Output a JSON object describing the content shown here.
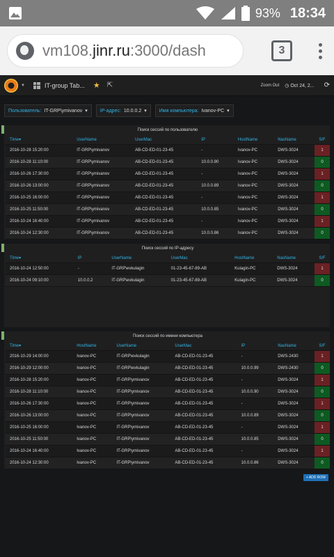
{
  "statusbar": {
    "battery": "93%",
    "time": "18:34"
  },
  "browser": {
    "url_prefix": "vm108.",
    "url_domain": "jinr.ru",
    "url_suffix": ":3000/dash",
    "tab_count": "3"
  },
  "grafana": {
    "dashboard_title": "IT-group Tab...",
    "zoom_out": "Zoom Out",
    "time_range": "Oct 24, 2..."
  },
  "variables": [
    {
      "label": "Пользователь:",
      "value": "IT-GRP\\ymivanov"
    },
    {
      "label": "IP-адрес:",
      "value": "10.0.0.2"
    },
    {
      "label": "Имя компьютера:",
      "value": "Ivanov-PC"
    }
  ],
  "panel1": {
    "title": "Поиск сессий по пользователю",
    "columns": [
      "Time",
      "UserName",
      "UserMac",
      "IP",
      "HostName",
      "NasName",
      "S/F"
    ],
    "rows": [
      [
        "2016-10-28 15:20:00",
        "IT-GRP\\ymivanov",
        "AB-CD-ED-01-23-45",
        "-",
        "Ivanov-PC",
        "DWS-3024",
        "1"
      ],
      [
        "2016-10-28 11:10:00",
        "IT-GRP\\ymivanov",
        "AB-CD-ED-01-23-45",
        "10.0.0.90",
        "Ivanov-PC",
        "DWS-3024",
        "0"
      ],
      [
        "2016-10-26 17:30:00",
        "IT-GRP\\ymivanov",
        "AB-CD-ED-01-23-45",
        "-",
        "Ivanov-PC",
        "DWS-3024",
        "1"
      ],
      [
        "2016-10-26 13:00:00",
        "IT-GRP\\ymivanov",
        "AB-CD-ED-01-23-45",
        "10.0.0.89",
        "Ivanov-PC",
        "DWS-3024",
        "0"
      ],
      [
        "2016-10-25 16:00:00",
        "IT-GRP\\ymivanov",
        "AB-CD-ED-01-23-45",
        "-",
        "Ivanov-PC",
        "DWS-3024",
        "1"
      ],
      [
        "2016-10-25 11:50:00",
        "IT-GRP\\ymivanov",
        "AB-CD-ED-01-23-45",
        "10.0.0.85",
        "Ivanov-PC",
        "DWS-3024",
        "0"
      ],
      [
        "2016-10-24 16:40:00",
        "IT-GRP\\ymivanov",
        "AB-CD-ED-01-23-45",
        "-",
        "Ivanov-PC",
        "DWS-3024",
        "1"
      ],
      [
        "2016-10-24 12:30:00",
        "IT-GRP\\ymivanov",
        "AB-CD-ED-01-23-45",
        "10.0.0.86",
        "Ivanov-PC",
        "DWS-3024",
        "0"
      ]
    ]
  },
  "panel2": {
    "title": "Поиск сессий по IP-адресу",
    "columns": [
      "Time",
      "IP",
      "UserName",
      "UserMac",
      "HostName",
      "NasName",
      "S/F"
    ],
    "rows": [
      [
        "2016-10-24 12:50:00",
        "-",
        "IT-GRP\\evkulagin",
        "01-23-45-67-89-AB",
        "Kulagin-PC",
        "DWS-3024",
        "1"
      ],
      [
        "2016-10-24 09:10:00",
        "10.0.0.2",
        "IT-GRP\\evkulagin",
        "01-23-45-67-89-AB",
        "Kulagin-PC",
        "DWS-3024",
        "0"
      ]
    ]
  },
  "panel3": {
    "title": "Поиск сессий по имени компьютера",
    "columns": [
      "Time",
      "HostName",
      "UserName",
      "UserMac",
      "IP",
      "NasName",
      "S/F"
    ],
    "rows": [
      [
        "2016-10-29 14:00:00",
        "Ivanov-PC",
        "IT-GRP\\evkulagin",
        "AB-CD-ED-01-23-45",
        "-",
        "DWS-2430",
        "1"
      ],
      [
        "2016-10-29 12:00:00",
        "Ivanov-PC",
        "IT-GRP\\evkulagin",
        "AB-CD-ED-01-23-45",
        "10.0.0.99",
        "DWS-2430",
        "0"
      ],
      [
        "2016-10-28 15:20:00",
        "Ivanov-PC",
        "IT-GRP\\ymivanov",
        "AB-CD-ED-01-23-45",
        "-",
        "DWS-3024",
        "1"
      ],
      [
        "2016-10-28 11:10:00",
        "Ivanov-PC",
        "IT-GRP\\ymivanov",
        "AB-CD-ED-01-23-45",
        "10.0.0.90",
        "DWS-3024",
        "0"
      ],
      [
        "2016-10-26 17:30:00",
        "Ivanov-PC",
        "IT-GRP\\ymivanov",
        "AB-CD-ED-01-23-45",
        "-",
        "DWS-3024",
        "1"
      ],
      [
        "2016-10-26 13:00:00",
        "Ivanov-PC",
        "IT-GRP\\ymivanov",
        "AB-CD-ED-01-23-45",
        "10.0.0.89",
        "DWS-3024",
        "0"
      ],
      [
        "2016-10-25 16:00:00",
        "Ivanov-PC",
        "IT-GRP\\ymivanov",
        "AB-CD-ED-01-23-45",
        "-",
        "DWS-3024",
        "1"
      ],
      [
        "2016-10-25 11:50:00",
        "Ivanov-PC",
        "IT-GRP\\ymivanov",
        "AB-CD-ED-01-23-45",
        "10.0.0.85",
        "DWS-3024",
        "0"
      ],
      [
        "2016-10-24 16:40:00",
        "Ivanov-PC",
        "IT-GRP\\ymivanov",
        "AB-CD-ED-01-23-45",
        "-",
        "DWS-3024",
        "1"
      ],
      [
        "2016-10-24 12:30:00",
        "Ivanov-PC",
        "IT-GRP\\ymivanov",
        "AB-CD-ED-01-23-45",
        "10.0.0.86",
        "DWS-3024",
        "0"
      ]
    ]
  },
  "add_row_label": "ADD ROW",
  "colors": {
    "accent": "#33b5e5",
    "fail": "#6a2124",
    "success": "#0e5a22",
    "mark": "#7eb26d"
  }
}
